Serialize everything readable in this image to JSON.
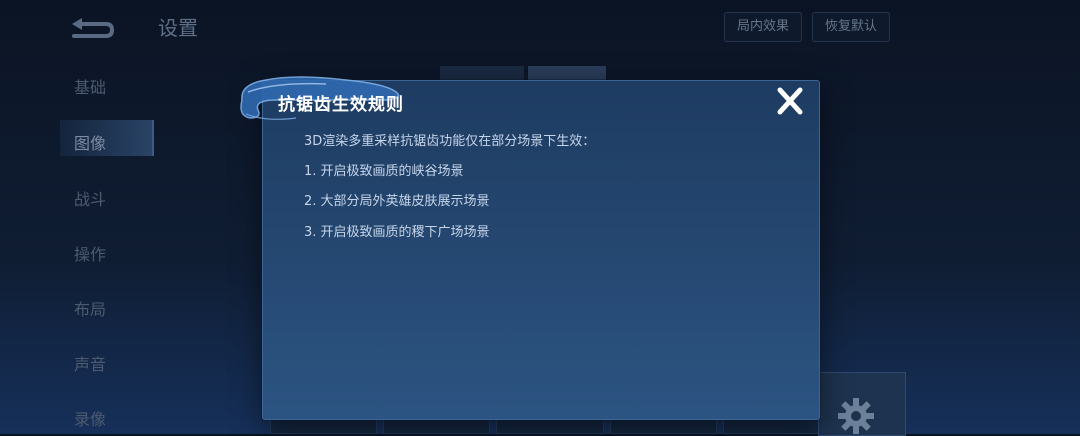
{
  "header": {
    "title": "设置",
    "buttons": [
      "局内效果",
      "恢复默认"
    ]
  },
  "sidebar": {
    "items": [
      "基础",
      "图像",
      "战斗",
      "操作",
      "布局",
      "声音",
      "录像"
    ],
    "active_index": 1
  },
  "dialog": {
    "title": "抗锯齿生效规则",
    "lines": [
      "3D渲染多重采样抗锯齿功能仅在部分场景下生效：",
      "1. 开启极致画质的峡谷场景",
      "2. 大部分局外英雄皮肤展示场景",
      "3. 开启极致画质的稷下广场场景"
    ],
    "close_icon": "close-icon"
  },
  "colors": {
    "dialog_bg": "#24466f",
    "dialog_border": "#3d6596",
    "title_text": "#ffffff",
    "body_text": "#c6d5ea"
  }
}
